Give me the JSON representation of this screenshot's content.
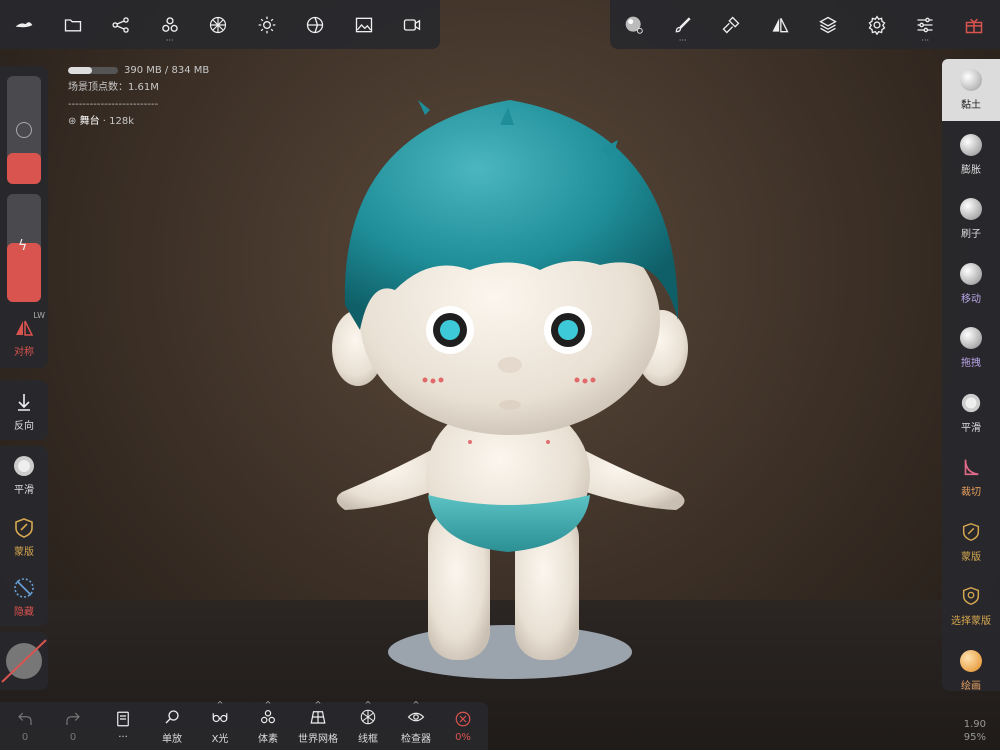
{
  "top_toolbar_left": {
    "items": [
      "brand-logo-icon",
      "folder-icon",
      "share-graph-icon",
      "scene-objects-icon",
      "grid-sphere-icon",
      "light-sun-icon",
      "material-ball-icon",
      "image-icon",
      "video-camera-icon"
    ]
  },
  "top_toolbar_right": {
    "items": [
      "material-preview-icon",
      "brush-icon",
      "paint-roller-icon",
      "symmetry-icon",
      "layers-icon",
      "settings-gear-icon",
      "sliders-icon",
      "gift-icon"
    ]
  },
  "stats": {
    "memory": "390 MB / 834 MB",
    "memory_fraction": 0.47,
    "vertex_count": "场景顶点数：1.61M",
    "separator": "-------------------------",
    "object_label": "舞台",
    "object_value": "128k"
  },
  "left_panel": {
    "radius_value": 0.29,
    "intensity_value": 0.55,
    "symmetry_label": "对称",
    "symmetry_badge": "LW",
    "reverse_label": "反向",
    "smooth_label": "平滑",
    "mask_label": "蒙版",
    "hide_label": "隐藏"
  },
  "right_tools": [
    {
      "label": "黏土",
      "active": true
    },
    {
      "label": "膨胀",
      "active": false
    },
    {
      "label": "刷子",
      "active": false
    },
    {
      "label": "移动",
      "active": false
    },
    {
      "label": "拖拽",
      "active": false
    },
    {
      "label": "平滑",
      "active": false
    },
    {
      "label": "裁切",
      "active": false
    },
    {
      "label": "蒙版",
      "active": false
    },
    {
      "label": "选择蒙版",
      "active": false
    },
    {
      "label": "绘画",
      "active": false
    }
  ],
  "bottom_bar": {
    "undo_count": "0",
    "redo_count": "0",
    "single_label": "单放",
    "xray_label": "X光",
    "voxel_label": "体素",
    "world_grid_label": "世界网格",
    "wireframe_label": "线框",
    "inspector_label": "检查器",
    "close_percent": "0%"
  },
  "viewport": {
    "zoom_value": "1.90",
    "zoom_percent": "95%"
  },
  "colors": {
    "accent_red": "#d9534f",
    "hair_teal": "#1f8e98",
    "right_label_purple": "#b9a6e8",
    "right_label_orange": "#e8a060"
  }
}
